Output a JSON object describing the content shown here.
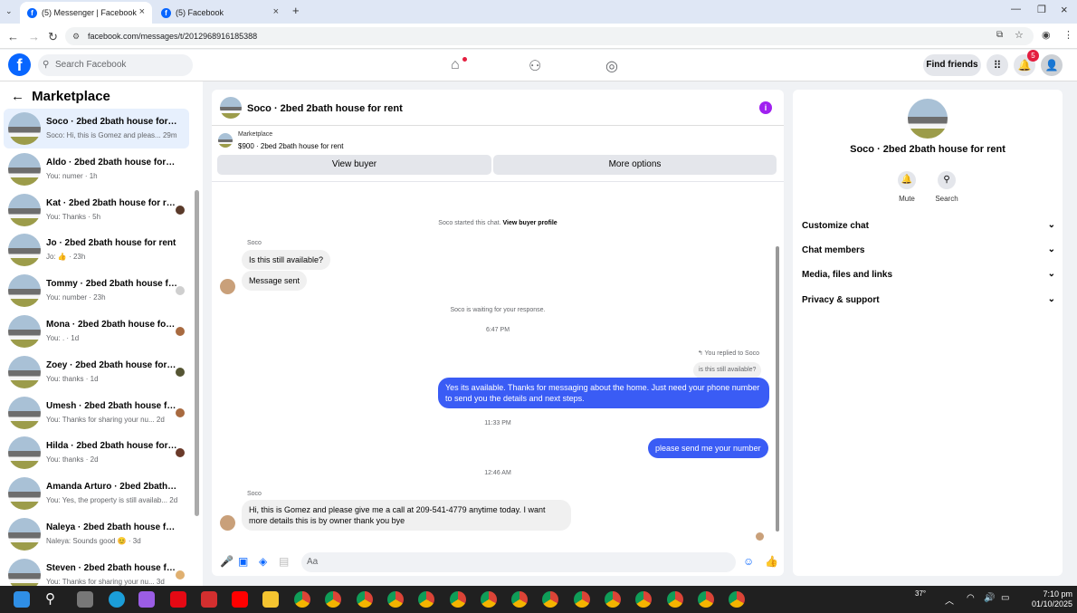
{
  "browser": {
    "tabs": [
      {
        "title": "(5) Messenger | Facebook"
      },
      {
        "title": "(5) Facebook"
      }
    ],
    "url": "facebook.com/messages/t/2012968916185388"
  },
  "header": {
    "search_placeholder": "Search Facebook",
    "find_friends": "Find friends",
    "notification_count": "5"
  },
  "sidebar": {
    "title": "Marketplace",
    "conversations": [
      {
        "name": "Soco · 2bed 2bath house for rent",
        "snippet": "Soco: Hi, this is Gomez and pleas...",
        "time": "29m"
      },
      {
        "name": "Aldo · 2bed 2bath house for rent",
        "snippet": "You: numer · 1h",
        "time": ""
      },
      {
        "name": "Kat · 2bed 2bath house for rent",
        "snippet": "You: Thanks · 5h",
        "time": ""
      },
      {
        "name": "Jo · 2bed 2bath house for rent",
        "snippet": "Jo: 👍 · 23h",
        "time": ""
      },
      {
        "name": "Tommy · 2bed 2bath house fo...",
        "snippet": "You: number · 23h",
        "time": ""
      },
      {
        "name": "Mona · 2bed 2bath house for ...",
        "snippet": "You: . · 1d",
        "time": ""
      },
      {
        "name": "Zoey · 2bed 2bath house for r...",
        "snippet": "You: thanks · 1d",
        "time": ""
      },
      {
        "name": "Umesh · 2bed 2bath house fo...",
        "snippet": "You: Thanks for sharing your nu...",
        "time": "2d"
      },
      {
        "name": "Hilda · 2bed 2bath house for r...",
        "snippet": "You: thanks · 2d",
        "time": ""
      },
      {
        "name": "Amanda Arturo · 2bed 2bath ho...",
        "snippet": "You: Yes, the property is still availab...",
        "time": "2d"
      },
      {
        "name": "Naleya · 2bed 2bath house for r...",
        "snippet": "Naleya: Sounds good 😊 · 3d",
        "time": ""
      },
      {
        "name": "Steven · 2bed 2bath house for...",
        "snippet": "You: Thanks for sharing your nu...",
        "time": "3d"
      }
    ]
  },
  "chat": {
    "title": "Soco · 2bed 2bath house for rent",
    "listing_label": "Marketplace",
    "listing_text": "$900 · 2bed 2bath house for rent",
    "view_buyer": "View buyer",
    "more_options": "More options",
    "started": "Soco started this chat.",
    "view_profile": "View buyer profile",
    "sender1": "Soco",
    "msg1": "Is this still available?",
    "msg2": "Message sent",
    "waiting": "Soco is waiting for your response.",
    "time1": "6:47 PM",
    "replied_to": "You replied to Soco",
    "quoted": "is this still available?",
    "msg3": "Yes its available. Thanks for messaging about the home. Just need your phone number to send you the details and next steps.",
    "time2": "11:33 PM",
    "msg4": "please send me your number",
    "time3": "12:46 AM",
    "sender2": "Soco",
    "msg5": "Hi, this is Gomez and please give me a call at 209-541-4779 anytime today. I want more details this is by owner thank you bye",
    "compose_placeholder": "Aa"
  },
  "right_panel": {
    "name": "Soco · 2bed 2bath house for rent",
    "mute": "Mute",
    "search": "Search",
    "sections": [
      "Customize chat",
      "Chat members",
      "Media, files and links",
      "Privacy & support"
    ]
  },
  "taskbar": {
    "temp": "37°",
    "time": "7:10 pm",
    "date": "01/10/2025"
  },
  "colors": {
    "brand": "#0866ff",
    "outgoing_bubble": "#3a5cf5",
    "info": "#a020f0"
  }
}
